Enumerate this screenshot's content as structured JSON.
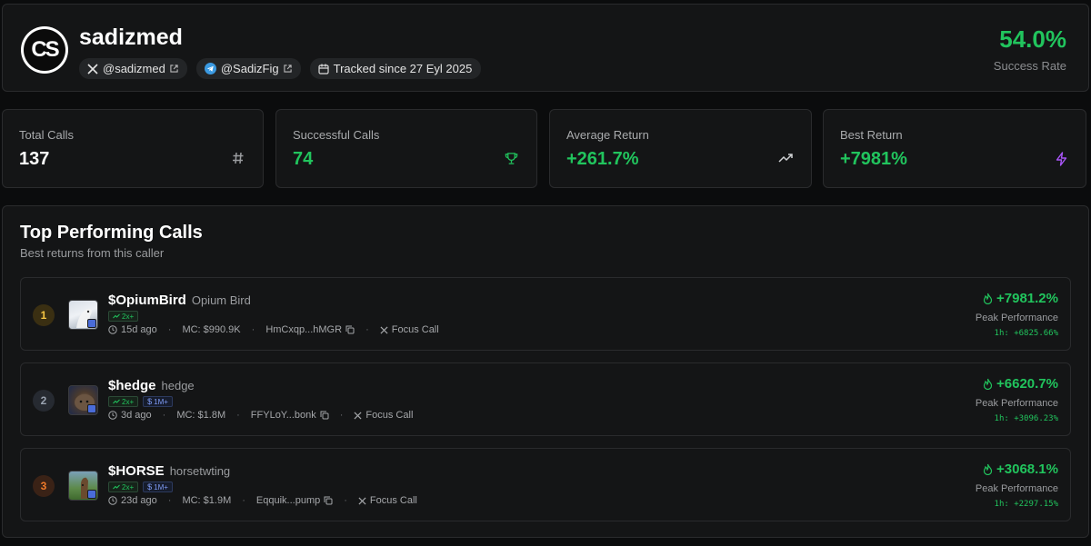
{
  "profile": {
    "avatar_text": "CS",
    "username": "sadizmed",
    "x_handle": "@sadizmed",
    "telegram_handle": "@SadizFig",
    "tracked_since": "Tracked since 27 Eyl 2025",
    "success_rate": "54.0%",
    "success_rate_label": "Success Rate"
  },
  "stats": [
    {
      "label": "Total Calls",
      "value": "137",
      "icon": "hash-icon"
    },
    {
      "label": "Successful Calls",
      "value": "74",
      "icon": "trophy-icon"
    },
    {
      "label": "Average Return",
      "value": "+261.7%",
      "icon": "trending-up-icon"
    },
    {
      "label": "Best Return",
      "value": "+7981%",
      "icon": "lightning-icon"
    }
  ],
  "top_calls": {
    "title": "Top Performing Calls",
    "subtitle": "Best returns from this caller",
    "items": [
      {
        "rank": "1",
        "ticker": "$OpiumBird",
        "name": "Opium Bird",
        "badges": [
          "2x+"
        ],
        "age": "15d ago",
        "mc": "MC: $990.9K",
        "address": "HmCxqp...hMGR",
        "focus": "Focus Call",
        "peak": "+7981.2%",
        "peak_label": "Peak Performance",
        "one_hour": "1h: +6825.66%"
      },
      {
        "rank": "2",
        "ticker": "$hedge",
        "name": "hedge",
        "badges": [
          "2x+",
          "1M+"
        ],
        "age": "3d ago",
        "mc": "MC: $1.8M",
        "address": "FFYLoY...bonk",
        "focus": "Focus Call",
        "peak": "+6620.7%",
        "peak_label": "Peak Performance",
        "one_hour": "1h: +3096.23%"
      },
      {
        "rank": "3",
        "ticker": "$HORSE",
        "name": "horsetwting",
        "badges": [
          "2x+",
          "1M+"
        ],
        "age": "23d ago",
        "mc": "MC: $1.9M",
        "address": "Eqquik...pump",
        "focus": "Focus Call",
        "peak": "+3068.1%",
        "peak_label": "Peak Performance",
        "one_hour": "1h: +2297.15%"
      }
    ]
  },
  "colors": {
    "accent_green": "#21c45d",
    "rank1": "#f5c542",
    "rank2": "#9aa3b0",
    "rank3": "#f07a2a"
  }
}
